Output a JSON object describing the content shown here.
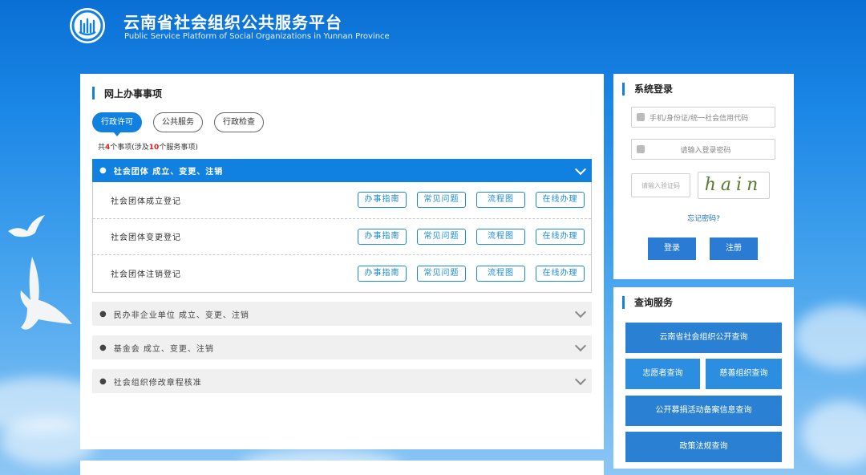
{
  "header": {
    "title": "云南省社会组织公共服务平台",
    "subtitle": "Public Service Platform of Social Organizations in Yunnan Province"
  },
  "main": {
    "section_title": "网上办事事项",
    "tabs": [
      {
        "label": "行政许可",
        "active": true
      },
      {
        "label": "公共服务",
        "active": false
      },
      {
        "label": "行政检查",
        "active": false
      }
    ],
    "count": {
      "prefix": "共",
      "items": "4",
      "middle": "个事项(涉及",
      "services": "10",
      "suffix": "个服务事项)"
    },
    "open_group": {
      "title": "社会团体 成立、变更、注销",
      "rows": [
        {
          "label": "社会团体成立登记"
        },
        {
          "label": "社会团体变更登记"
        },
        {
          "label": "社会团体注销登记"
        }
      ],
      "actions": [
        "办事指南",
        "常见问题",
        "流程图",
        "在线办理"
      ]
    },
    "closed_groups": [
      {
        "title": "民办非企业单位 成立、变更、注销"
      },
      {
        "title": "基金会 成立、变更、注销"
      },
      {
        "title": "社会组织修改章程核准"
      }
    ]
  },
  "login": {
    "title": "系统登录",
    "user_placeholder": "手机/身份证/统一社会信用代码",
    "pass_placeholder": "请输入登录密码",
    "code_placeholder": "请输入验证码",
    "captcha": "hain",
    "forgot": "忘记密码?",
    "login_btn": "登录",
    "register_btn": "注册"
  },
  "query": {
    "title": "查询服务",
    "buttons": [
      "云南省社会组织公开查询",
      "志愿者查询",
      "慈善组织查询",
      "公开募捐活动备案信息查询",
      "政策法规查询"
    ]
  },
  "colors": {
    "accent": "#1081e0",
    "link": "#1a8ad8"
  }
}
